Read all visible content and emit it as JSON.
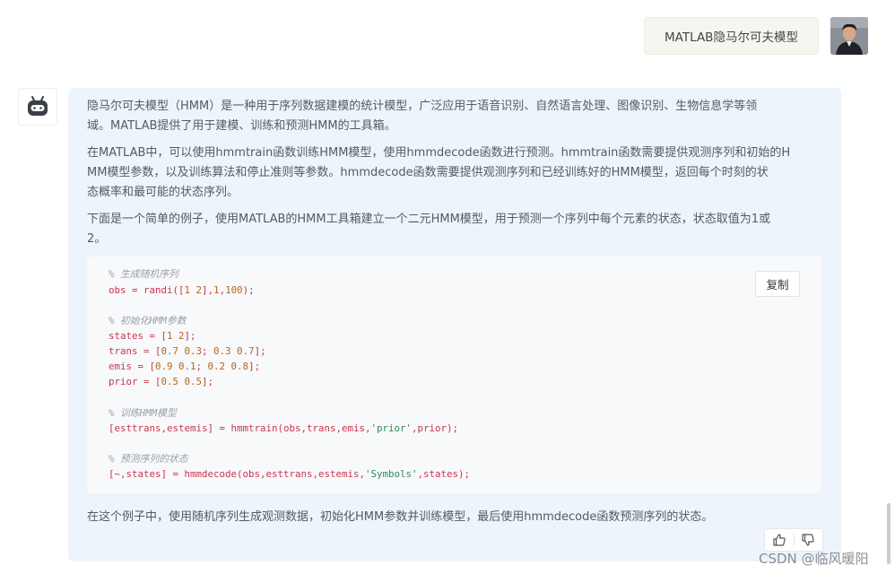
{
  "user_message": "MATLAB隐马尔可夫模型",
  "answer": {
    "paragraphs": [
      "隐马尔可夫模型（HMM）是一种用于序列数据建模的统计模型，广泛应用于语音识别、自然语言处理、图像识别、生物信息学等领\n域。MATLAB提供了用于建模、训练和预测HMM的工具箱。",
      "在MATLAB中，可以使用hmmtrain函数训练HMM模型，使用hmmdecode函数进行预测。hmmtrain函数需要提供观测序列和初始的H\nMM模型参数，以及训练算法和停止准则等参数。hmmdecode函数需要提供观测序列和已经训练好的HMM模型，返回每个时刻的状\n态概率和最可能的状态序列。",
      "下面是一个简单的例子，使用MATLAB的HMM工具箱建立一个二元HMM模型，用于预测一个序列中每个元素的状态，状态取值为1或\n2。"
    ],
    "code": {
      "copy_label": "复制",
      "lines": {
        "c1": "% 生成随机序列",
        "l1_a": "obs = randi([",
        "l1_b": "1 2",
        "l1_c": "],",
        "l1_d": "1",
        "l1_e": ",",
        "l1_f": "100",
        "l1_g": ");",
        "c2": "% 初始化HMM参数",
        "l2_a": "states = [",
        "l2_b": "1 2",
        "l2_c": "];",
        "l3_a": "trans = [",
        "l3_b": "0.7 0.3",
        "l3_c": "; ",
        "l3_d": "0.3 0.7",
        "l3_e": "];",
        "l4_a": "emis = [",
        "l4_b": "0.9 0.1",
        "l4_c": "; ",
        "l4_d": "0.2 0.8",
        "l4_e": "];",
        "l5_a": "prior = [",
        "l5_b": "0.5 0.5",
        "l5_c": "];",
        "c3": "% 训练HMM模型",
        "l6_a": "[esttrans,estemis] = hmmtrain(obs,trans,emis,",
        "l6_b": "'prior'",
        "l6_c": ",prior);",
        "c4": "% 预测序列的状态",
        "l7_a": "[~,states] = hmmdecode(obs,esttrans,estemis,",
        "l7_b": "'Symbols'",
        "l7_c": ",states);"
      }
    },
    "conclusion": "在这个例子中，使用随机序列生成观测数据，初始化HMM参数并训练模型，最后使用hmmdecode函数预测序列的状态。"
  },
  "reactions": {
    "like_icon": "thumbs-up-icon",
    "dislike_icon": "thumbs-down-icon"
  },
  "watermark": "CSDN @临风暖阳"
}
